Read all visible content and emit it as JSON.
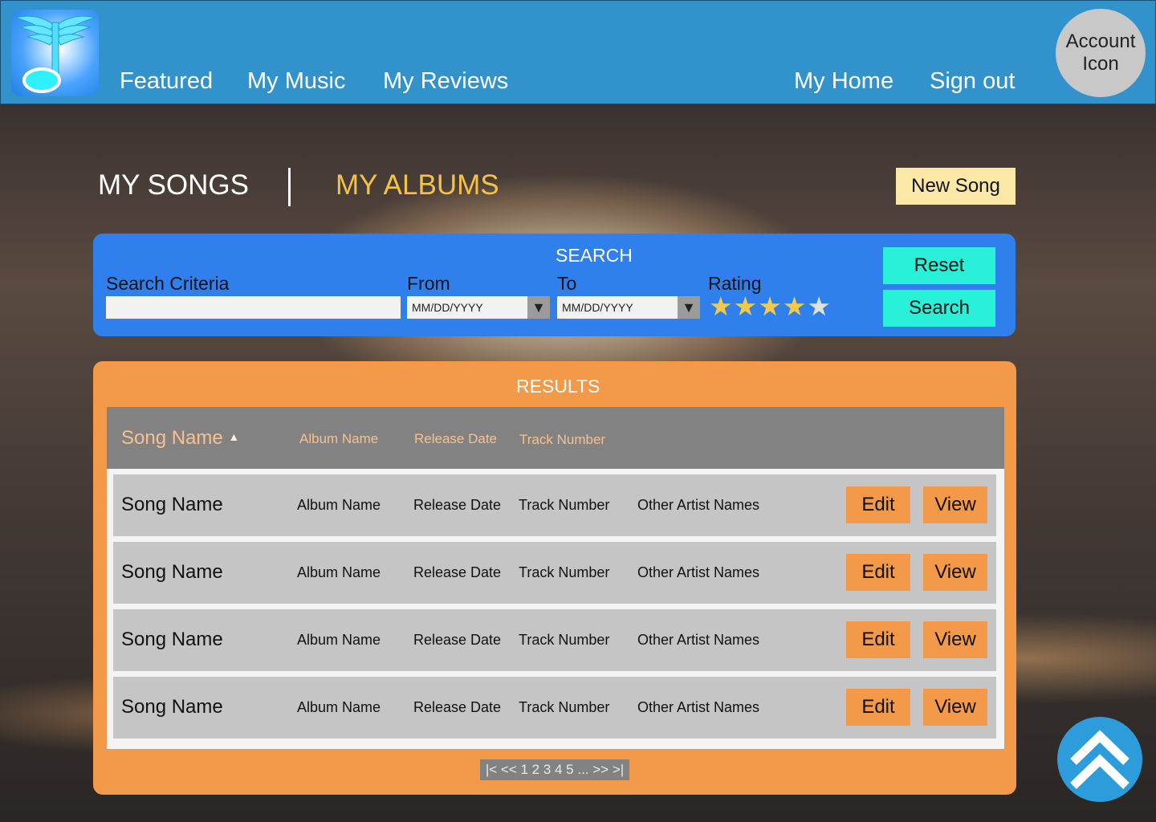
{
  "nav": {
    "links": [
      "Featured",
      "My Music",
      "My Reviews"
    ],
    "right_links": [
      "My Home",
      "Sign out"
    ],
    "account_label": "Account Icon"
  },
  "tabs": {
    "songs": "MY SONGS",
    "albums": "MY ALBUMS"
  },
  "new_song_label": "New Song",
  "search": {
    "title": "SEARCH",
    "criteria_label": "Search Criteria",
    "criteria_value": "",
    "from_label": "From",
    "from_placeholder": "MM/DD/YYYY",
    "to_label": "To",
    "to_placeholder": "MM/DD/YYYY",
    "rating_label": "Rating",
    "rating_value": 4,
    "rating_max": 5,
    "reset_label": "Reset",
    "search_label": "Search"
  },
  "results": {
    "title": "RESULTS",
    "headers": {
      "song": "Song Name",
      "sort_indicator": "▲",
      "album": "Album Name",
      "release": "Release Date",
      "track": "Track Number"
    },
    "rows": [
      {
        "song": "Song Name",
        "album": "Album Name",
        "release": "Release Date",
        "track": "Track Number",
        "artists": "Other Artist Names",
        "edit": "Edit",
        "view": "View"
      },
      {
        "song": "Song Name",
        "album": "Album Name",
        "release": "Release Date",
        "track": "Track Number",
        "artists": "Other Artist Names",
        "edit": "Edit",
        "view": "View"
      },
      {
        "song": "Song Name",
        "album": "Album Name",
        "release": "Release Date",
        "track": "Track Number",
        "artists": "Other Artist Names",
        "edit": "Edit",
        "view": "View"
      },
      {
        "song": "Song Name",
        "album": "Album Name",
        "release": "Release Date",
        "track": "Track Number",
        "artists": "Other Artist Names",
        "edit": "Edit",
        "view": "View"
      }
    ],
    "pagination": "|< << 1 2 3 4 5 ... >> >|"
  },
  "colors": {
    "nav_bg": "#3293cc",
    "search_bg": "#2f80ed",
    "results_bg": "#f2994a",
    "accent_teal": "#29f0d9",
    "tab_active": "#f4c247",
    "star_filled": "#f2c94c",
    "star_empty": "#e0e0e0"
  },
  "icons": {
    "logo": "music-note-wings-icon",
    "date_dropdown": "triangle-down-icon",
    "scroll_top": "double-chevron-up-icon"
  }
}
